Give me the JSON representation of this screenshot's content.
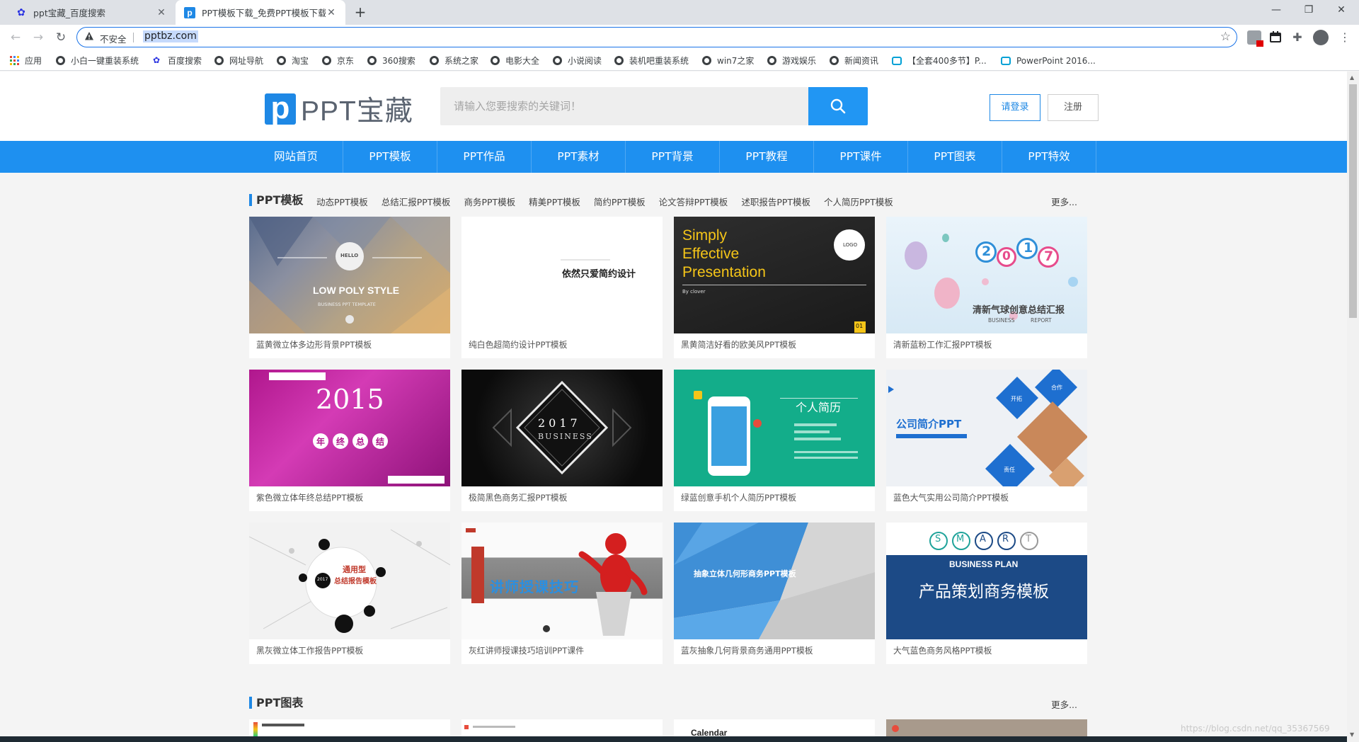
{
  "browser": {
    "tabs": [
      {
        "title": "ppt宝藏_百度搜索",
        "icon": "baidu-paw-icon"
      },
      {
        "title": "PPT模板下载_免费PPT模板下载...",
        "icon": "pptbz-icon"
      }
    ],
    "insecure_label": "不安全",
    "url": "pptbz.com",
    "bookmarks": [
      "应用",
      "小白一键重装系统",
      "百度搜索",
      "网址导航",
      "淘宝",
      "京东",
      "360搜索",
      "系统之家",
      "电影大全",
      "小说阅读",
      "装机吧重装系统",
      "win7之家",
      "游戏娱乐",
      "新闻资讯",
      "【全套400多节】P...",
      "PowerPoint 2016..."
    ]
  },
  "site": {
    "logo_text": "PPT宝藏",
    "logo_mark": "p",
    "search_placeholder": "请输入您要搜索的关键词！",
    "login_label": "请登录",
    "register_label": "注册",
    "nav": [
      "网站首页",
      "PPT模板",
      "PPT作品",
      "PPT素材",
      "PPT背景",
      "PPT教程",
      "PPT课件",
      "PPT图表",
      "PPT特效"
    ],
    "accent_color": "#1e90f0"
  },
  "section_templates": {
    "title": "PPT模板",
    "subcategories": [
      "动态PPT模板",
      "总结汇报PPT模板",
      "商务PPT模板",
      "精美PPT模板",
      "简约PPT模板",
      "论文答辩PPT模板",
      "述职报告PPT模板",
      "个人简历PPT模板"
    ],
    "more": "更多...",
    "cards": [
      {
        "title": "蓝黄微立体多边形背景PPT模板",
        "thumb_text": [
          "LOW POLY STYLE",
          "BUSINESS PPT TEMPLATE",
          "HELLO"
        ]
      },
      {
        "title": "纯白色超简约设计PPT模板",
        "thumb_text": [
          "依然只爱简约设计"
        ]
      },
      {
        "title": "黑黄简洁好看的欧美风PPT模板",
        "thumb_text": [
          "Simply",
          "Effective",
          "Presentation",
          "By clover",
          "LOGO",
          "01"
        ]
      },
      {
        "title": "清新蓝粉工作汇报PPT模板",
        "thumb_text": [
          "2",
          "0",
          "1",
          "7",
          "清新气球创意总结汇报",
          "BUSINESS",
          "REPORT"
        ]
      },
      {
        "title": "紫色微立体年终总结PPT模板",
        "thumb_text": [
          "2015",
          "年",
          "终",
          "总",
          "结"
        ]
      },
      {
        "title": "极简黑色商务汇报PPT模板",
        "thumb_text": [
          "2017",
          "BUSINESS"
        ]
      },
      {
        "title": "绿蓝创意手机个人简历PPT模板",
        "thumb_text": [
          "个人简历"
        ]
      },
      {
        "title": "蓝色大气实用公司简介PPT模板",
        "thumb_text": [
          "公司简介PPT",
          "开拓",
          "合作",
          "责任"
        ]
      },
      {
        "title": "黑灰微立体工作报告PPT模板",
        "thumb_text": [
          "通用型",
          "总结报告模板",
          "2017"
        ]
      },
      {
        "title": "灰红讲师授课技巧培训PPT课件",
        "thumb_text": [
          "讲师授课技巧"
        ]
      },
      {
        "title": "蓝灰抽象几何背景商务通用PPT模板",
        "thumb_text": [
          "抽象立体几何形商务PPT模板"
        ]
      },
      {
        "title": "大气蓝色商务风格PPT模板",
        "thumb_text": [
          "S",
          "M",
          "A",
          "R",
          "T",
          "BUSINESS PLAN",
          "产品策划商务模板"
        ]
      }
    ]
  },
  "section_charts": {
    "title": "PPT图表",
    "more": "更多...",
    "preview_text": [
      "Calendar"
    ]
  },
  "watermark": "https://blog.csdn.net/qq_35367569"
}
